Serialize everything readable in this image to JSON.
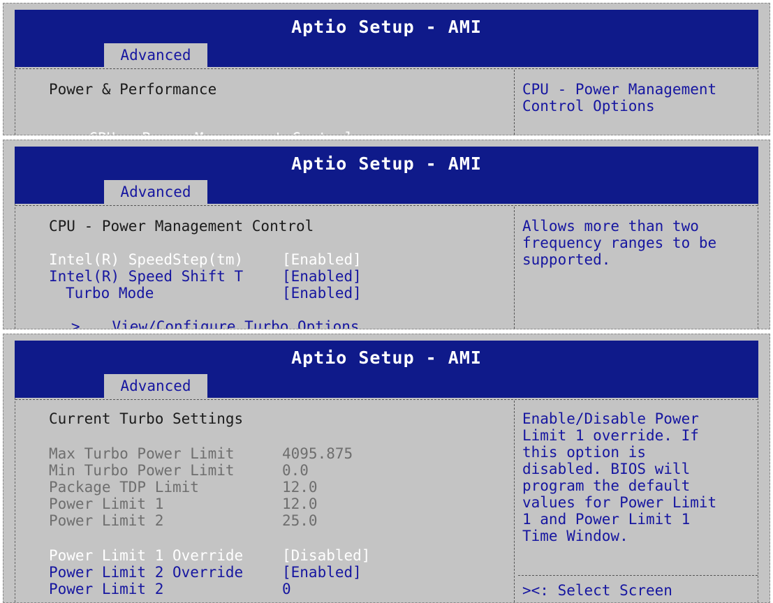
{
  "panels": [
    {
      "title": "Aptio Setup - AMI",
      "tab": "Advanced",
      "heading": "Power & Performance",
      "items": [
        {
          "prefix": "> ",
          "label": "CPU - Power Management Control",
          "value": ""
        }
      ],
      "help": [
        "CPU - Power Management",
        "Control Options"
      ]
    },
    {
      "title": "Aptio Setup - AMI",
      "tab": "Advanced",
      "heading": "CPU - Power Management Control",
      "items": [
        {
          "label": "Intel(R) SpeedStep(tm)",
          "value": "[Enabled]"
        },
        {
          "label": "Intel(R) Speed Shift T",
          "value": "[Enabled]"
        },
        {
          "label": "Turbo Mode",
          "value": "[Enabled]"
        },
        {
          "prefix": ">",
          "label": "View/Configure Turbo Options",
          "value": ""
        }
      ],
      "help": [
        "Allows more than two",
        "frequency ranges to be",
        "supported."
      ]
    },
    {
      "title": "Aptio Setup - AMI",
      "tab": "Advanced",
      "heading": "Current Turbo Settings",
      "info_rows": [
        {
          "label": "Max Turbo Power Limit",
          "value": "4095.875"
        },
        {
          "label": "Min Turbo Power Limit",
          "value": "0.0"
        },
        {
          "label": "Package TDP Limit",
          "value": "12.0"
        },
        {
          "label": "Power Limit 1",
          "value": "12.0"
        },
        {
          "label": "Power Limit 2",
          "value": "25.0"
        }
      ],
      "items": [
        {
          "label": "Power Limit 1 Override",
          "value": "[Disabled]"
        },
        {
          "label": "Power Limit 2 Override",
          "value": "[Enabled]"
        },
        {
          "label": "Power Limit 2",
          "value": "0"
        }
      ],
      "help": [
        "Enable/Disable Power",
        "Limit 1 override. If",
        "this option is",
        "disabled. BIOS will",
        "program the default",
        "values for Power Limit",
        "1 and Power Limit 1",
        "Time Window."
      ],
      "keys": [
        "><: Select Screen"
      ]
    }
  ],
  "colors": {
    "header_bg": "#0f1a8a",
    "body_bg": "#c4c4c4",
    "selected": "#ffffff",
    "option": "#1616a0",
    "info": "#6e6e6e"
  }
}
